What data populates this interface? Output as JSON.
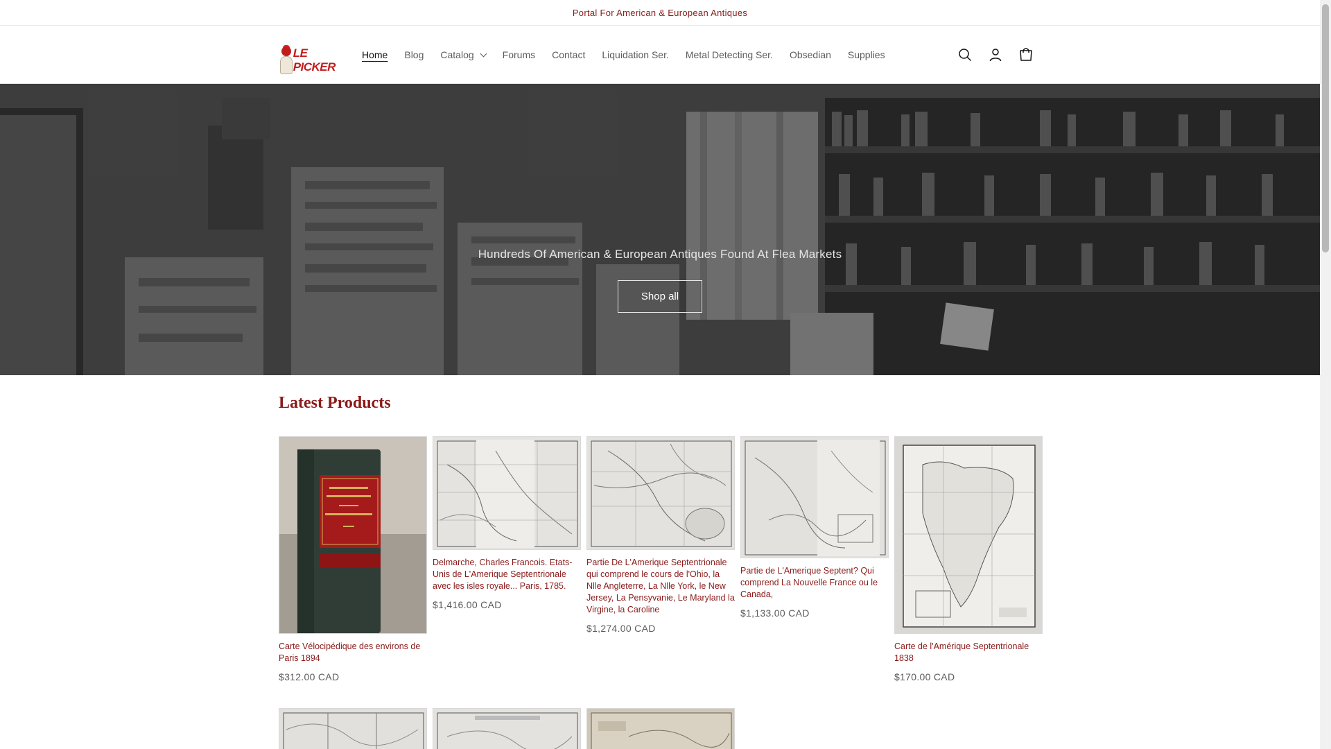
{
  "announcement": "Portal For American & European Antiques",
  "brand": {
    "logo_text": "LE PICKER"
  },
  "nav": {
    "items": [
      {
        "label": "Home",
        "active": true
      },
      {
        "label": "Blog"
      },
      {
        "label": "Catalog",
        "dropdown": true
      },
      {
        "label": "Forums"
      },
      {
        "label": "Contact"
      },
      {
        "label": "Liquidation Ser."
      },
      {
        "label": "Metal Detecting Ser."
      },
      {
        "label": "Obsedian"
      },
      {
        "label": "Supplies"
      }
    ],
    "icons": [
      "search-icon",
      "account-icon",
      "cart-icon"
    ]
  },
  "hero": {
    "headline": "Hundreds Of American & European Antiques Found At Flea Markets",
    "button": "Shop all"
  },
  "latest": {
    "title": "Latest Products",
    "products": [
      {
        "title": "Carte Vélocipédique des environs de Paris 1894",
        "price": "$312.00 CAD"
      },
      {
        "title": "Delmarche, Charles Francois. Etats-Unis de L'Amerique Septentrionale avec les isles royale... Paris, 1785.",
        "price": "$1,416.00 CAD"
      },
      {
        "title": "Partie De L'Amerique Septentrionale qui comprend le cours de l'Ohio, la Nlle Angleterre, La Nlle York, le New Jersey, La Pensyvanie, Le Maryland la Virgine, la Caroline",
        "price": "$1,274.00 CAD"
      },
      {
        "title": "Partie de L'Amerique Septent? Qui comprend La Nouvelle France ou le Canada,",
        "price": "$1,133.00 CAD"
      },
      {
        "title": "Carte de l'Amérique Septentrionale 1838",
        "price": "$170.00 CAD"
      }
    ]
  },
  "colors": {
    "accent": "#8b1a1a",
    "text_muted": "#5c5c5c"
  }
}
